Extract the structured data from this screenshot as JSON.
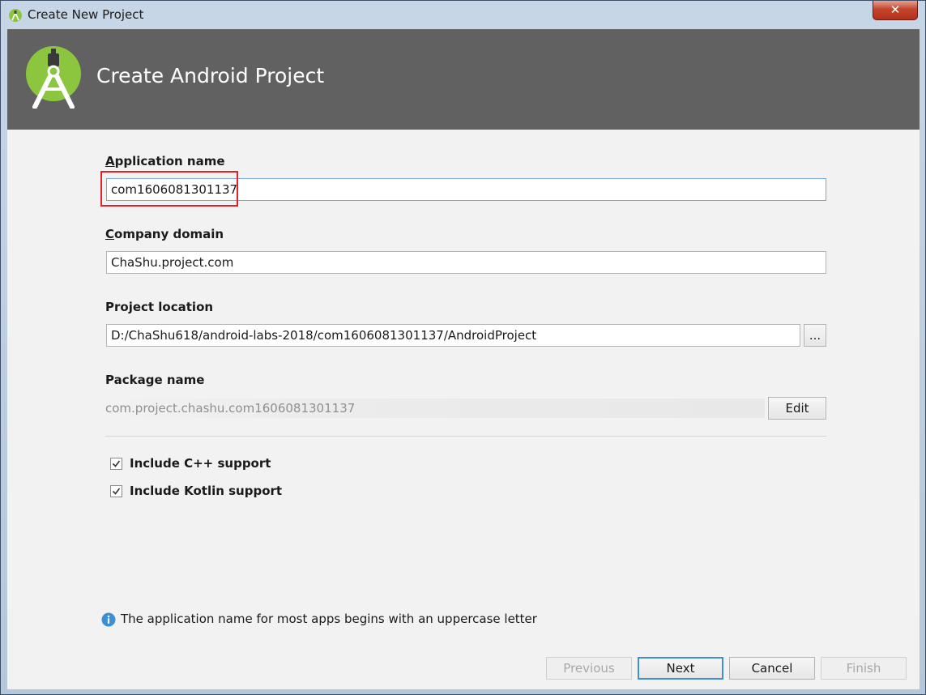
{
  "window": {
    "title": "Create New Project",
    "close_glyph": "✕",
    "icon": "android-studio-icon"
  },
  "banner": {
    "title": "Create Android Project",
    "logo": "android-studio-logo"
  },
  "form": {
    "app_name": {
      "label_accel": "A",
      "label_rest": "pplication name",
      "value": "com1606081301137"
    },
    "company_domain": {
      "label_accel": "C",
      "label_rest": "ompany domain",
      "value": "ChaShu.project.com"
    },
    "project_location": {
      "label": "Project location",
      "value": "D:/ChaShu618/android-labs-2018/com1606081301137/AndroidProject",
      "browse_label": "..."
    },
    "package_name": {
      "label": "Package name",
      "value": "com.project.chashu.com1606081301137",
      "edit_label": "Edit"
    }
  },
  "options": {
    "cpp": {
      "label": "Include C++ support",
      "checked": true
    },
    "kotlin": {
      "label": "Include Kotlin support",
      "checked": true
    }
  },
  "info": {
    "icon": "info-icon",
    "text": "The application name for most apps begins with an uppercase letter"
  },
  "footer": {
    "previous": "Previous",
    "next": "Next",
    "cancel": "Cancel",
    "finish": "Finish"
  },
  "colors": {
    "banner": "#616161",
    "android_green": "#8cc63f",
    "focus_border": "#3f8fd6",
    "highlight_box": "#e0232b"
  }
}
